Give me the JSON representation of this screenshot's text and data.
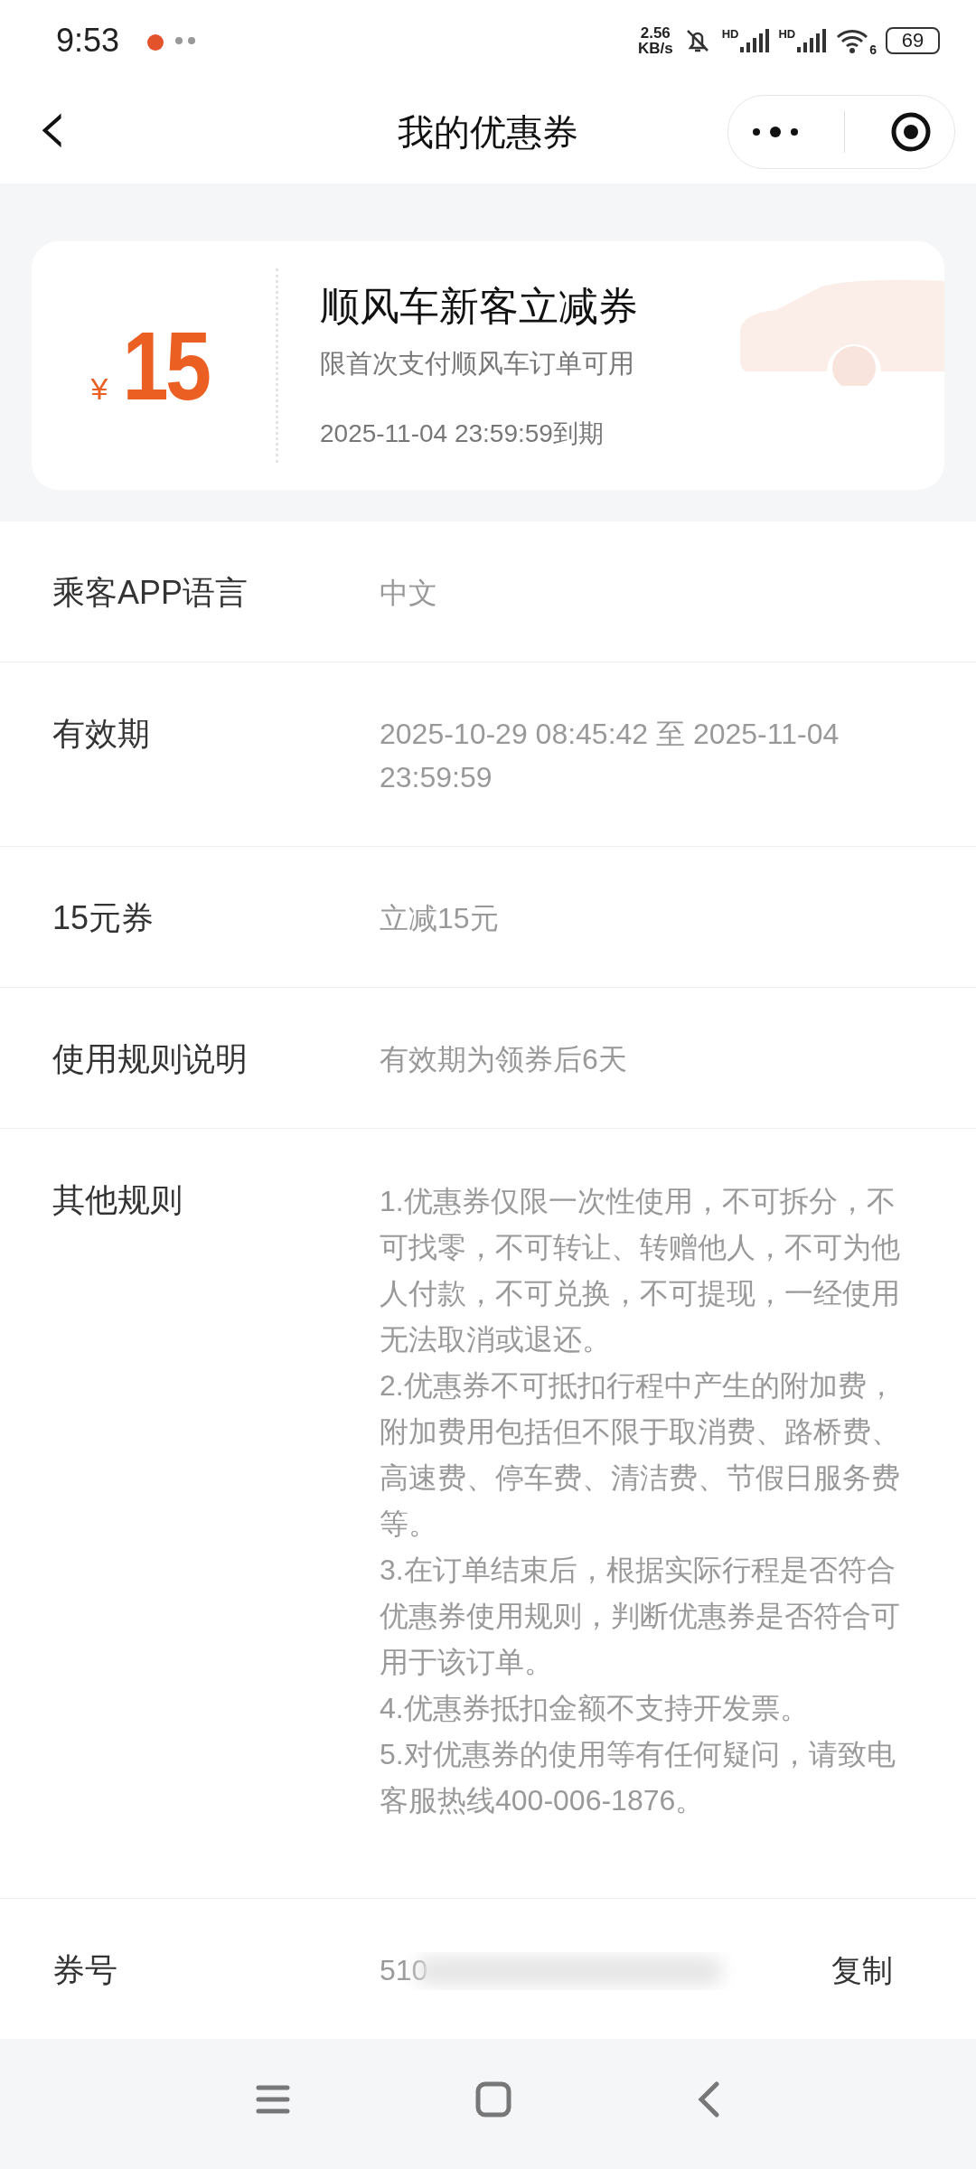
{
  "status_bar": {
    "time": "9:53",
    "net_speed": [
      "2.56",
      "KB/s"
    ],
    "signal_labels": [
      "HD",
      "HD"
    ],
    "wifi_label": "6",
    "battery": "69"
  },
  "nav": {
    "title": "我的优惠券",
    "back_glyph": "‹"
  },
  "coupon": {
    "currency": "¥",
    "amount": "15",
    "title": "顺风车新客立减券",
    "subtitle": "限首次支付顺风车订单可用",
    "expiry": "2025-11-04 23:59:59到期"
  },
  "details": [
    {
      "kind": "text",
      "label": "乘客APP语言",
      "value": "中文"
    },
    {
      "kind": "text",
      "label": "有效期",
      "value": "2025-10-29 08:45:42 至 2025-11-04 23:59:59"
    },
    {
      "kind": "text",
      "label": "15元券",
      "value": "立减15元"
    },
    {
      "kind": "text",
      "label": "使用规则说明",
      "value": "有效期为领券后6天"
    },
    {
      "kind": "rules",
      "label": "其他规则",
      "paragraphs": [
        "1.优惠券仅限一次性使用，不可拆分，不可找零，不可转让、转赠他人，不可为他人付款，不可兑换，不可提现，一经使用无法取消或退还。",
        "2.优惠券不可抵扣行程中产生的附加费，附加费用包括但不限于取消费、路桥费、高速费、停车费、清洁费、节假日服务费等。",
        "3.在订单结束后，根据实际行程是否符合优惠券使用规则，判断优惠券是否符合可用于该订单。",
        "4.优惠券抵扣金额不支持开发票。",
        "5.对优惠券的使用等有任何疑问，请致电客服热线400-006-1876。"
      ]
    },
    {
      "kind": "code",
      "label": "券号",
      "value": "510",
      "action": "复制"
    }
  ]
}
